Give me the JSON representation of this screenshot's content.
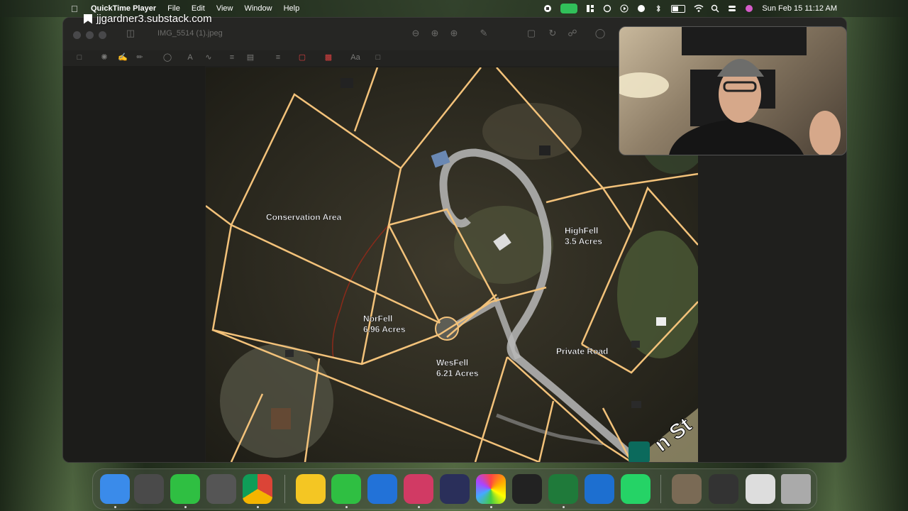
{
  "menubar": {
    "app_name": "QuickTime Player",
    "menus": [
      "File",
      "Edit",
      "View",
      "Window",
      "Help"
    ],
    "clock": "Sun Feb 15  11:12 AM"
  },
  "site_label": "jjgardner3.substack.com",
  "window": {
    "doc_title": "IMG_5514 (1).jpeg"
  },
  "map": {
    "labels": {
      "conservation": "Conservation Area",
      "highfell_name": "HighFell",
      "highfell_size": "3.5 Acres",
      "norfell_name": "NorFell",
      "norfell_size": "6.96 Acres",
      "wesfell_name": "WesFell",
      "wesfell_size": "6.21 Acres",
      "private_road": "Private Road",
      "street": "n St"
    },
    "colors": {
      "parcel_line": "#f3c27a",
      "road": "#b9b9b9",
      "trail": "#8a2a1a"
    }
  },
  "dock": {
    "apps": [
      "finder-icon",
      "launchpad-icon",
      "messages-icon",
      "recording-icon",
      "chrome-icon",
      "notes-icon",
      "phone-icon",
      "sync-icon",
      "rocket-icon",
      "arc-icon",
      "photos-icon",
      "spark-icon",
      "excel-icon",
      "quicktime-icon",
      "whatsapp-icon",
      "image-thumb-icon",
      "terminal-thumb-icon",
      "plan-thumb-icon",
      "trash-icon"
    ]
  }
}
